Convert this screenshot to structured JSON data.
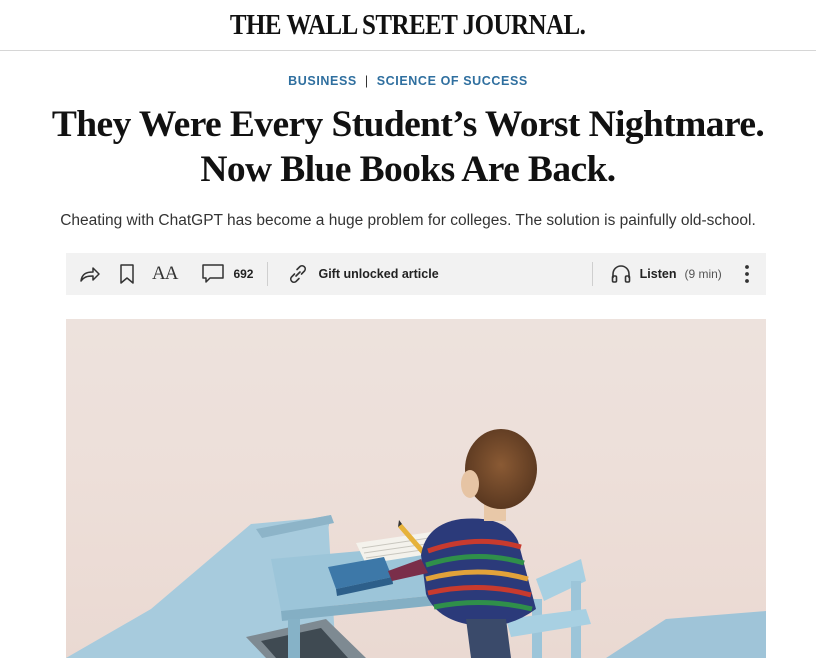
{
  "masthead": {
    "logo": "THE WALL STREET JOURNAL."
  },
  "flashline": {
    "section": "BUSINESS",
    "separator": "|",
    "subsection": "SCIENCE OF SUCCESS"
  },
  "article": {
    "headline_line1": "They Were Every Student’s Worst Nightmare.",
    "headline_line2": "Now Blue Books Are Back.",
    "dek": "Cheating with ChatGPT has become a huge problem for colleges. The solution is painfully old-school."
  },
  "toolbar": {
    "share_icon": "share-arrow-icon",
    "save_icon": "bookmark-icon",
    "text_size_label": "AA",
    "comments_icon": "comment-bubble-icon",
    "comment_count": "692",
    "gift_icon": "link-icon",
    "gift_label": "Gift unlocked article",
    "listen_icon": "headphones-icon",
    "listen_label": "Listen",
    "listen_duration": "(9 min)",
    "more_icon": "vertical-ellipsis-icon"
  },
  "colors": {
    "flashline": "#2f6f9f",
    "toolbar_bg": "#f2f2f2",
    "hero_bg": "#ede2dd"
  }
}
